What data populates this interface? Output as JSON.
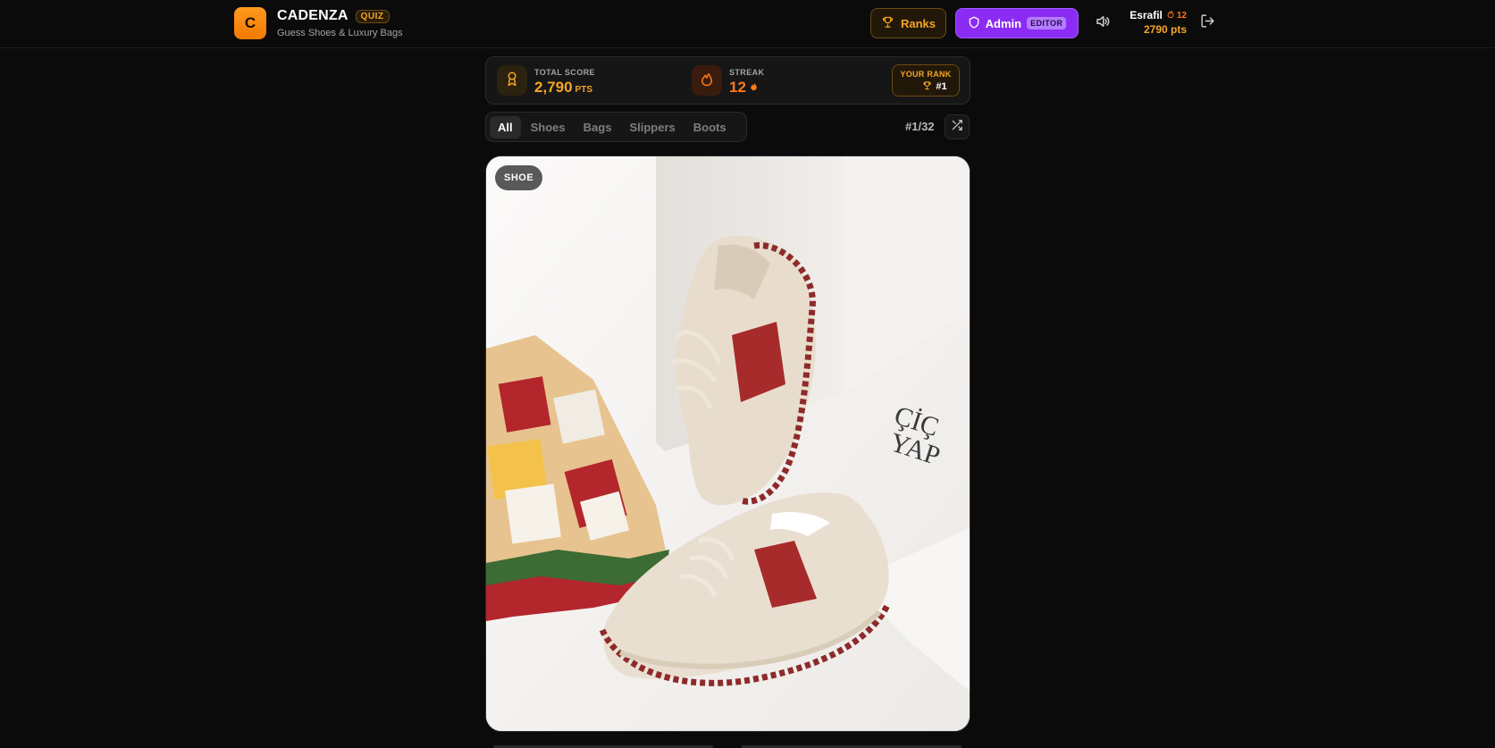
{
  "brand": {
    "logo_letter": "C",
    "name": "CADENZA",
    "tag": "QUIZ",
    "subtitle": "Guess Shoes & Luxury Bags"
  },
  "header": {
    "ranks_label": "Ranks",
    "admin_label": "Admin",
    "editor_badge": "EDITOR",
    "user": {
      "name": "Esrafil",
      "streak": "12",
      "points": "2790 pts"
    }
  },
  "stats": {
    "total_score_label": "TOTAL SCORE",
    "total_score_value": "2,790",
    "total_score_unit": "PTS",
    "streak_label": "STREAK",
    "streak_value": "12",
    "rank_label": "YOUR RANK",
    "rank_value": "#1"
  },
  "filters": {
    "tabs": [
      "All",
      "Shoes",
      "Bags",
      "Slippers",
      "Boots"
    ],
    "active": "All",
    "counter": "#1/32"
  },
  "card": {
    "type_badge": "SHOE"
  },
  "colors": {
    "accent": "#f5a524",
    "brand": "#ff8a0f",
    "admin": "#8b2cf5",
    "streak": "#ff7a1a",
    "background": "#0b0b0c"
  },
  "icons": {
    "ranks": "trophy-icon",
    "admin": "shield-icon",
    "sound": "speaker-icon",
    "logout": "logout-icon",
    "score": "medal-icon",
    "streak": "flame-icon",
    "shuffle": "shuffle-icon"
  }
}
